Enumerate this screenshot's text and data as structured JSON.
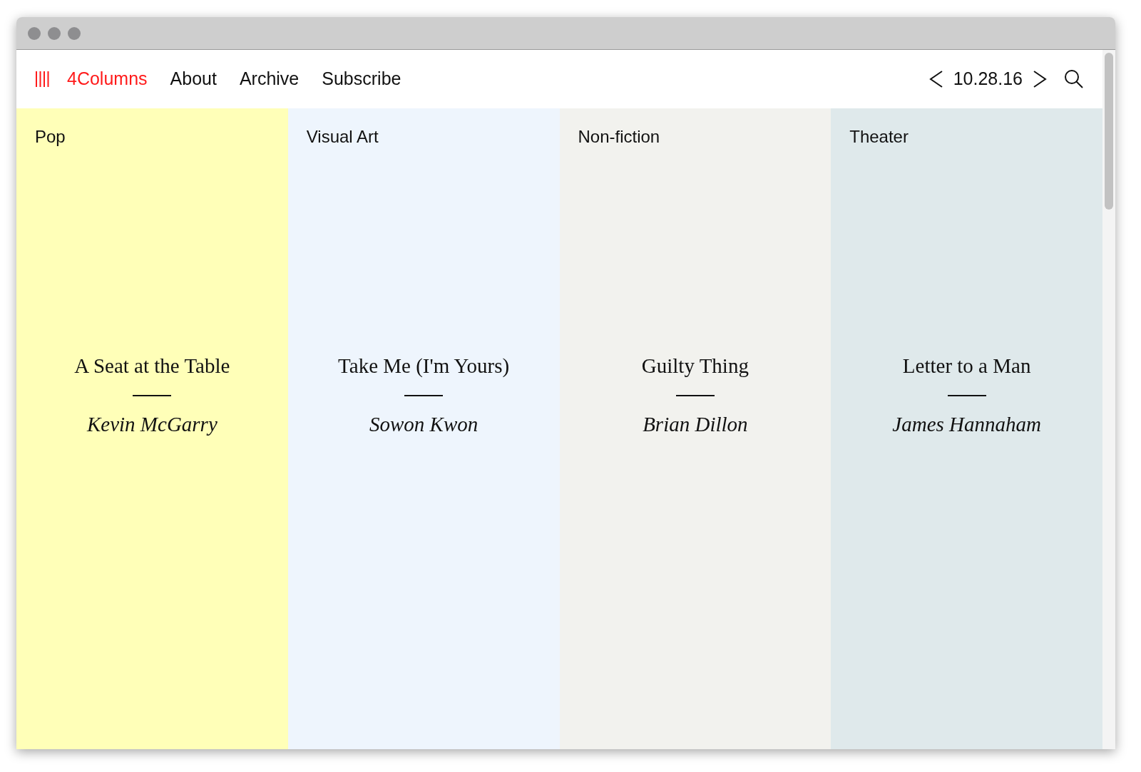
{
  "nav": {
    "brand": "4Columns",
    "links": [
      "About",
      "Archive",
      "Subscribe"
    ],
    "date": "10.28.16"
  },
  "columns": [
    {
      "category": "Pop",
      "title": "A Seat at the Table",
      "author": "Kevin McGarry",
      "color": "#ffffb8"
    },
    {
      "category": "Visual Art",
      "title": "Take Me (I'm Yours)",
      "author": "Sowon Kwon",
      "color": "#eef5fd"
    },
    {
      "category": "Non-fiction",
      "title": "Guilty Thing",
      "author": "Brian Dillon",
      "color": "#f2f2ee"
    },
    {
      "category": "Theater",
      "title": "Letter to a Man",
      "author": "James Hannaham",
      "color": "#dfe9eb"
    }
  ]
}
